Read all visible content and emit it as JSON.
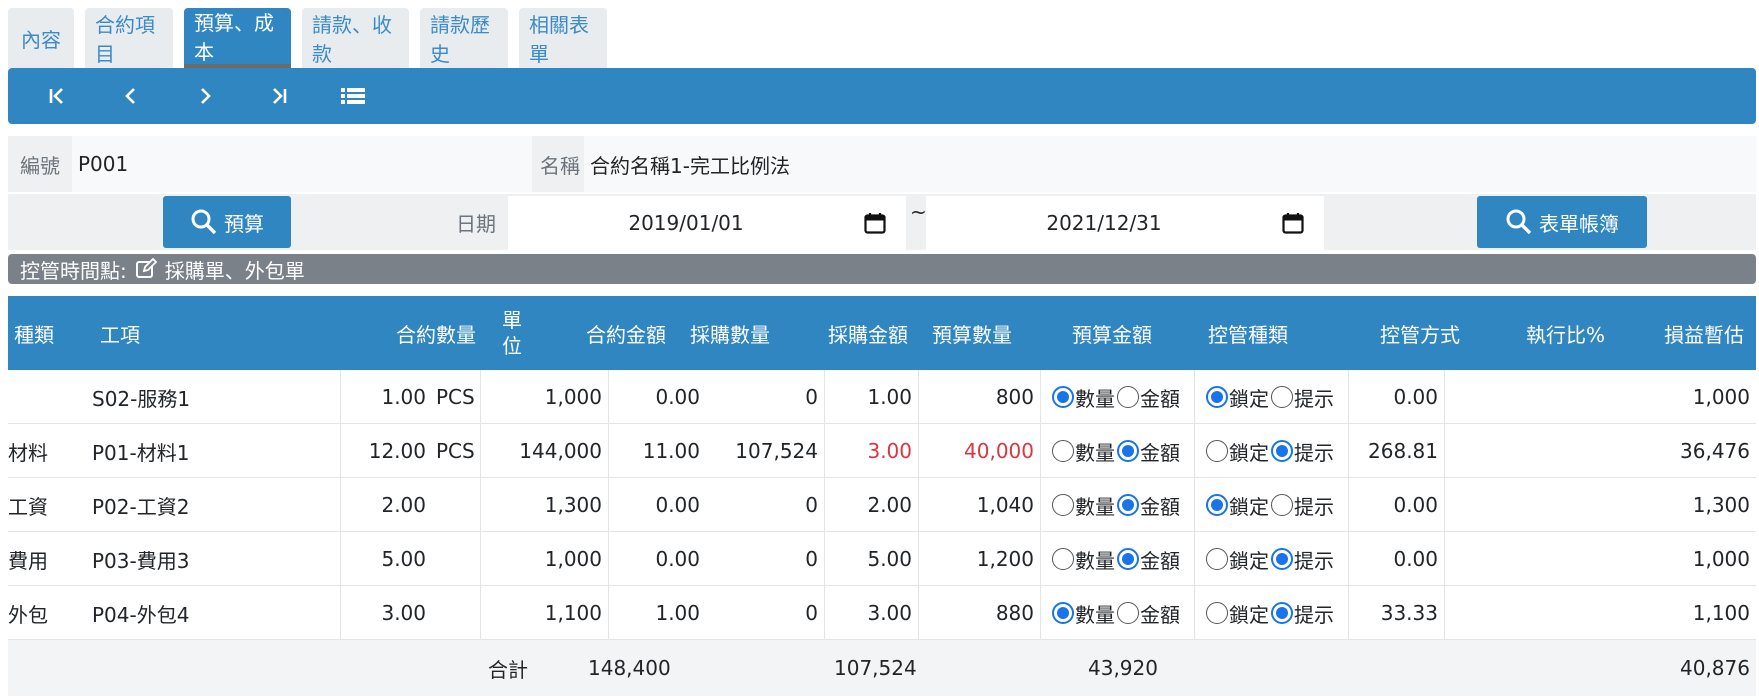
{
  "tabs": [
    {
      "label": "內容",
      "active": false
    },
    {
      "label": "合約項目",
      "active": false
    },
    {
      "label": "預算、成本",
      "active": true
    },
    {
      "label": "請款、收款",
      "active": false
    },
    {
      "label": "請款歷史",
      "active": false
    },
    {
      "label": "相關表單",
      "active": false
    }
  ],
  "form": {
    "code_label": "編號",
    "code_value": "P001",
    "name_label": "名稱",
    "name_value": "合約名稱1-完工比例法",
    "budget_button": "預算",
    "date_label": "日期",
    "date_from": "2019/01/01",
    "date_sep": "~",
    "date_to": "2021/12/31",
    "ledger_button": "表單帳簿"
  },
  "control_bar": {
    "label": "控管時間點:",
    "value": "採購單、外包單"
  },
  "table": {
    "headers": {
      "type": "種類",
      "item": "工項",
      "contract_qty": "合約數量",
      "unit": "單位",
      "contract_amt": "合約金額",
      "purchase_qty": "採購數量",
      "purchase_amt": "採購金額",
      "budget_qty": "預算數量",
      "budget_amt": "預算金額",
      "control_type": "控管種類",
      "control_mode": "控管方式",
      "exec_ratio": "執行比%",
      "profit": "損益暫估"
    },
    "radio_labels": {
      "qty": "數量",
      "amt": "金額",
      "lock": "鎖定",
      "hint": "提示"
    },
    "rows": [
      {
        "type": "",
        "item": "S02-服務1",
        "contract_qty": "1.00",
        "unit": "PCS",
        "contract_amt": "1,000",
        "purchase_qty": "0.00",
        "purchase_amt": "0",
        "budget_qty": "1.00",
        "budget_amt": "800",
        "control_type": "qty",
        "control_mode": "lock",
        "exec_ratio": "0.00",
        "profit": "1,000",
        "highlight": false
      },
      {
        "type": "材料",
        "item": "P01-材料1",
        "contract_qty": "12.00",
        "unit": "PCS",
        "contract_amt": "144,000",
        "purchase_qty": "11.00",
        "purchase_amt": "107,524",
        "budget_qty": "3.00",
        "budget_amt": "40,000",
        "control_type": "amt",
        "control_mode": "hint",
        "exec_ratio": "268.81",
        "profit": "36,476",
        "highlight": true
      },
      {
        "type": "工資",
        "item": "P02-工資2",
        "contract_qty": "2.00",
        "unit": "",
        "contract_amt": "1,300",
        "purchase_qty": "0.00",
        "purchase_amt": "0",
        "budget_qty": "2.00",
        "budget_amt": "1,040",
        "control_type": "amt",
        "control_mode": "lock",
        "exec_ratio": "0.00",
        "profit": "1,300",
        "highlight": false
      },
      {
        "type": "費用",
        "item": "P03-費用3",
        "contract_qty": "5.00",
        "unit": "",
        "contract_amt": "1,000",
        "purchase_qty": "0.00",
        "purchase_amt": "0",
        "budget_qty": "5.00",
        "budget_amt": "1,200",
        "control_type": "amt",
        "control_mode": "hint",
        "exec_ratio": "0.00",
        "profit": "1,000",
        "highlight": false
      },
      {
        "type": "外包",
        "item": "P04-外包4",
        "contract_qty": "3.00",
        "unit": "",
        "contract_amt": "1,100",
        "purchase_qty": "1.00",
        "purchase_amt": "0",
        "budget_qty": "3.00",
        "budget_amt": "880",
        "control_type": "qty",
        "control_mode": "hint",
        "exec_ratio": "33.33",
        "profit": "1,100",
        "highlight": false
      }
    ],
    "footer": {
      "label": "合計",
      "contract_amt": "148,400",
      "purchase_amt": "107,524",
      "budget_amt": "43,920",
      "profit": "40,876"
    }
  },
  "colors": {
    "primary": "#2f86c0",
    "warning_text": "#d9363e",
    "control_bar": "#7a8189"
  }
}
